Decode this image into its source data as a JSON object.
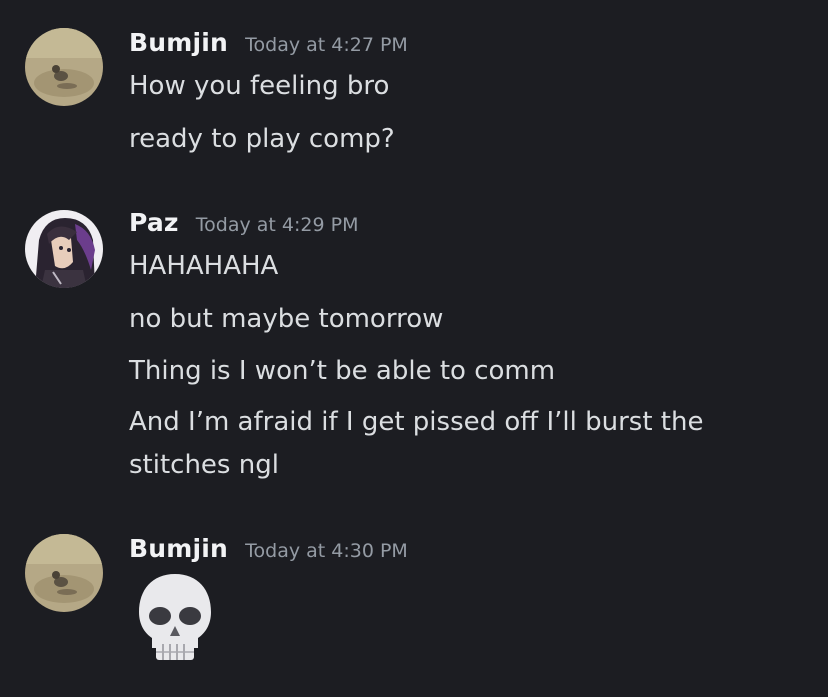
{
  "messages": [
    {
      "author": "Bumjin",
      "timestamp": "Today at 4:27 PM",
      "avatar": "duck-avatar",
      "lines": [
        "How you feeling bro",
        "ready to play comp?"
      ]
    },
    {
      "author": "Paz",
      "timestamp": "Today at 4:29 PM",
      "avatar": "anime-character-avatar",
      "lines": [
        "HAHAHAHA",
        "no but maybe tomorrow",
        "Thing is I won’t be able to comm",
        "And I’m afraid if I get pissed off I’ll burst the",
        "stitches ngl"
      ]
    },
    {
      "author": "Bumjin",
      "timestamp": "Today at 4:30 PM",
      "avatar": "duck-avatar",
      "emoji": "skull-emoji"
    }
  ],
  "colors": {
    "background": "#1c1d22",
    "author": "#f2f3f5",
    "timestamp": "#949ba4",
    "message_text": "#dbdee1"
  }
}
